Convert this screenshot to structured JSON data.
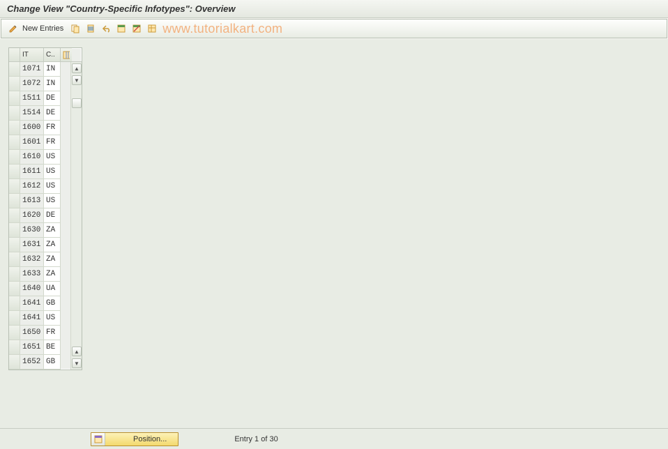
{
  "title": "Change View \"Country-Specific Infotypes\": Overview",
  "toolbar": {
    "new_entries_label": "New Entries"
  },
  "watermark": "www.tutorialkart.com",
  "table": {
    "col_it": "IT",
    "col_c": "C..",
    "rows": [
      {
        "it": "1071",
        "c": "IN"
      },
      {
        "it": "1072",
        "c": "IN"
      },
      {
        "it": "1511",
        "c": "DE"
      },
      {
        "it": "1514",
        "c": "DE"
      },
      {
        "it": "1600",
        "c": "FR"
      },
      {
        "it": "1601",
        "c": "FR"
      },
      {
        "it": "1610",
        "c": "US"
      },
      {
        "it": "1611",
        "c": "US"
      },
      {
        "it": "1612",
        "c": "US"
      },
      {
        "it": "1613",
        "c": "US"
      },
      {
        "it": "1620",
        "c": "DE"
      },
      {
        "it": "1630",
        "c": "ZA"
      },
      {
        "it": "1631",
        "c": "ZA"
      },
      {
        "it": "1632",
        "c": "ZA"
      },
      {
        "it": "1633",
        "c": "ZA"
      },
      {
        "it": "1640",
        "c": "UA"
      },
      {
        "it": "1641",
        "c": "GB"
      },
      {
        "it": "1641",
        "c": "US"
      },
      {
        "it": "1650",
        "c": "FR"
      },
      {
        "it": "1651",
        "c": "BE"
      },
      {
        "it": "1652",
        "c": "GB"
      }
    ]
  },
  "footer": {
    "position_label": "Position...",
    "entry_text": "Entry 1 of 30"
  }
}
